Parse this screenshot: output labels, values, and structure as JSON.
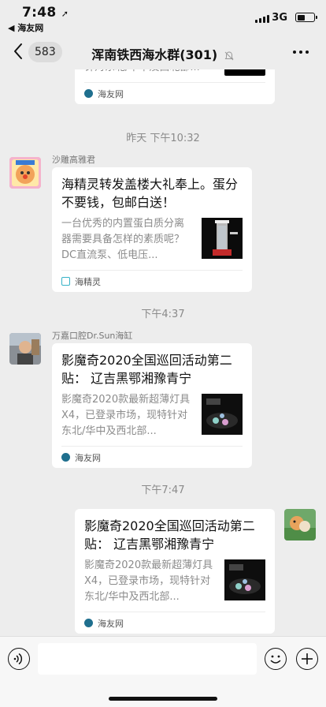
{
  "status_bar": {
    "time": "7:48",
    "back_app": "◀ 海友网",
    "network": "3G"
  },
  "nav": {
    "unread_count": "583",
    "title": "浑南铁西海水群(301)"
  },
  "messages": [
    {
      "id": "msg0",
      "desc_partial": "针对东北/华中及西北部...",
      "source": "海友网"
    },
    {
      "id": "msg1",
      "timestamp": "昨天 下午10:32",
      "sender": "沙雕高雅君",
      "title": "海精灵转发盖楼大礼奉上。蛋分不要钱，包邮白送！",
      "desc": "一台优秀的内置蛋白质分离器需要具备怎样的素质呢？DC直流泵、低电压...",
      "source": "海精灵"
    },
    {
      "id": "msg2",
      "timestamp": "下午4:37",
      "sender": "万嘉口腔Dr.Sun海缸",
      "title": "影魔奇2020全国巡回活动第二贴： 辽吉黑鄂湘豫青宁",
      "desc": "影魔奇2020款最新超薄灯具X4，已登录市场，现特针对东北/华中及西北部...",
      "source": "海友网"
    },
    {
      "id": "msg3",
      "timestamp": "下午7:47",
      "title": "影魔奇2020全国巡回活动第二贴： 辽吉黑鄂湘豫青宁",
      "desc": "影魔奇2020款最新超薄灯具X4，已登录市场，现特针对东北/华中及西北部...",
      "source": "海友网"
    }
  ]
}
